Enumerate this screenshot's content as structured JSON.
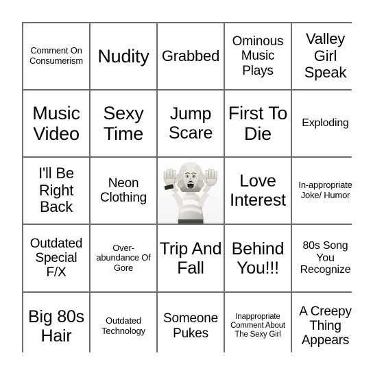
{
  "card": {
    "type": "bingo-card",
    "rows": 5,
    "columns": 5,
    "grid_color": "#6e6e6e",
    "background_color": "#ffffff",
    "text_color": "#000000",
    "cells": [
      [
        {
          "text": "Comment On Consumerism",
          "size": "xs",
          "kind": "text"
        },
        {
          "text": "Nudity",
          "size": "xxl",
          "kind": "text"
        },
        {
          "text": "Grabbed",
          "size": "l",
          "kind": "text"
        },
        {
          "text": "Ominous Music Plays",
          "size": "m",
          "kind": "text"
        },
        {
          "text": "Valley Girl Speak",
          "size": "l",
          "kind": "text"
        }
      ],
      [
        {
          "text": "Music Video",
          "size": "xxl",
          "kind": "text"
        },
        {
          "text": "Sexy Time",
          "size": "xxl",
          "kind": "text"
        },
        {
          "text": "Jump Scare",
          "size": "xl",
          "kind": "text"
        },
        {
          "text": "First To Die",
          "size": "xxl",
          "kind": "text"
        },
        {
          "text": "Exploding",
          "size": "s",
          "kind": "text"
        }
      ],
      [
        {
          "text": "I'll Be Right Back",
          "size": "l",
          "kind": "text"
        },
        {
          "text": "Neon Clothing",
          "size": "m",
          "kind": "text"
        },
        {
          "text": "",
          "size": "m",
          "kind": "image",
          "image_name": "screaming-woman-photo",
          "image_description": "Black and white vintage photo of a blonde woman screaming with both hands raised"
        },
        {
          "text": "Love Interest",
          "size": "xl",
          "kind": "text"
        },
        {
          "text": "In-appropriate Joke/ Humor",
          "size": "xs",
          "kind": "text"
        }
      ],
      [
        {
          "text": "Outdated Special F/X",
          "size": "m",
          "kind": "text"
        },
        {
          "text": "Over-abundance Of Gore",
          "size": "xs",
          "kind": "text"
        },
        {
          "text": "Trip And Fall",
          "size": "xl",
          "kind": "text"
        },
        {
          "text": "Behind You!!!",
          "size": "xl",
          "kind": "text"
        },
        {
          "text": "80s Song You Recognize",
          "size": "s",
          "kind": "text"
        }
      ],
      [
        {
          "text": "Big 80s Hair",
          "size": "xl",
          "kind": "text"
        },
        {
          "text": "Outdated Technology",
          "size": "xs",
          "kind": "text"
        },
        {
          "text": "Someone Pukes",
          "size": "m",
          "kind": "text"
        },
        {
          "text": "Inappropriate Comment About The Sexy Girl",
          "size": "xxs",
          "kind": "text"
        },
        {
          "text": "A Creepy Thing Appears",
          "size": "m",
          "kind": "text"
        }
      ]
    ]
  }
}
